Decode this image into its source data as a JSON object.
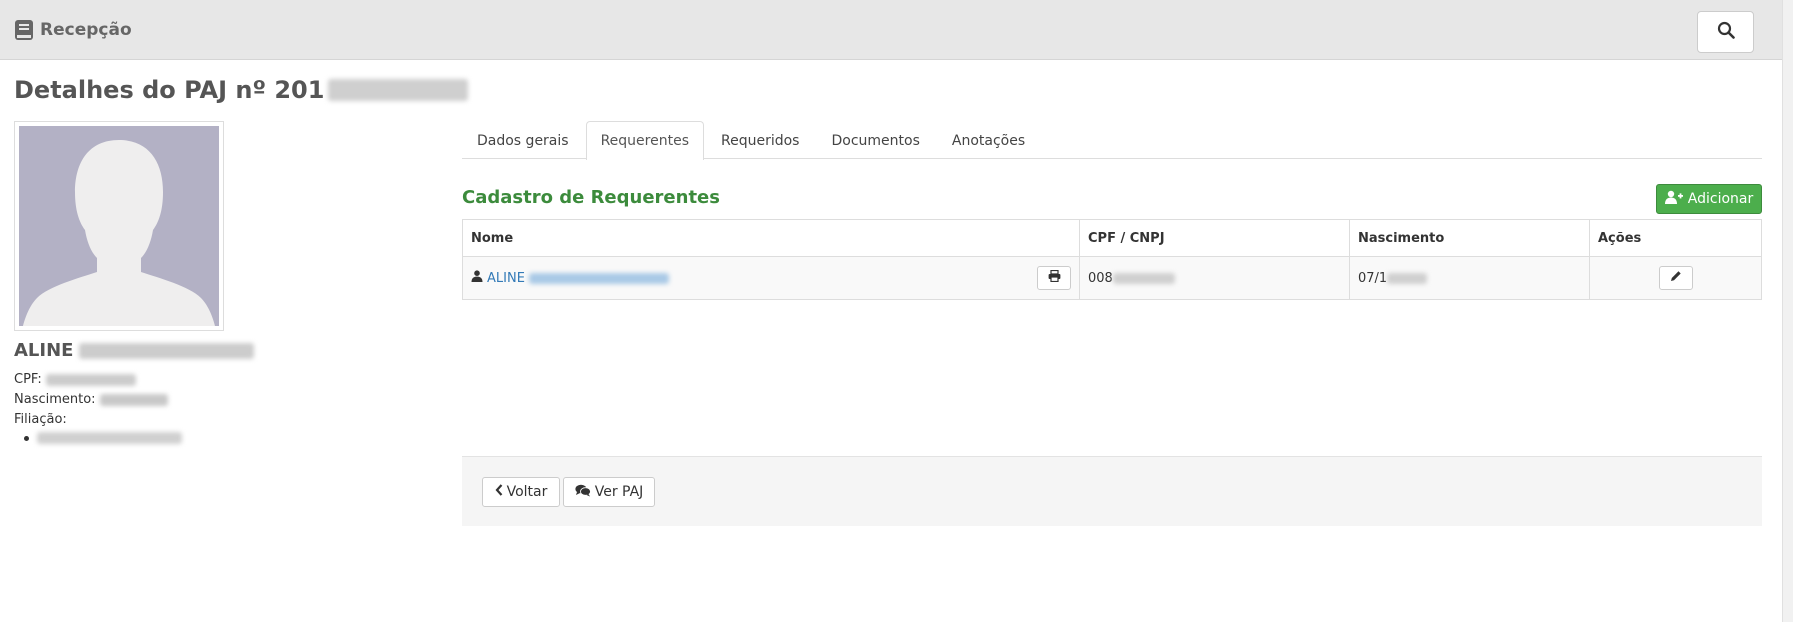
{
  "topbar": {
    "title": "Recepção",
    "icons": {
      "brand": "book-icon",
      "search": "search-icon"
    }
  },
  "page": {
    "title_prefix": "Detalhes do PAJ nº 201"
  },
  "profile": {
    "name_first": "ALINE",
    "cpf_label": "CPF:",
    "nascimento_label": "Nascimento:",
    "filiacao_label": "Filiação:"
  },
  "tabs": [
    {
      "label": "Dados gerais",
      "active": false
    },
    {
      "label": "Requerentes",
      "active": true
    },
    {
      "label": "Requeridos",
      "active": false
    },
    {
      "label": "Documentos",
      "active": false
    },
    {
      "label": "Anotações",
      "active": false
    }
  ],
  "section": {
    "title": "Cadastro de Requerentes",
    "add_label": "Adicionar"
  },
  "table": {
    "headers": [
      "Nome",
      "CPF / CNPJ",
      "Nascimento",
      "Ações"
    ],
    "rows": [
      {
        "name_first": "ALINE",
        "cpf_prefix": "008",
        "nascimento_prefix": "07/1"
      }
    ]
  },
  "footer": {
    "back_label": "Voltar",
    "view_label": "Ver PAJ"
  },
  "colors": {
    "accent_green": "#3c8b3c",
    "button_green": "#4cae4c",
    "link_blue": "#337ab7"
  }
}
